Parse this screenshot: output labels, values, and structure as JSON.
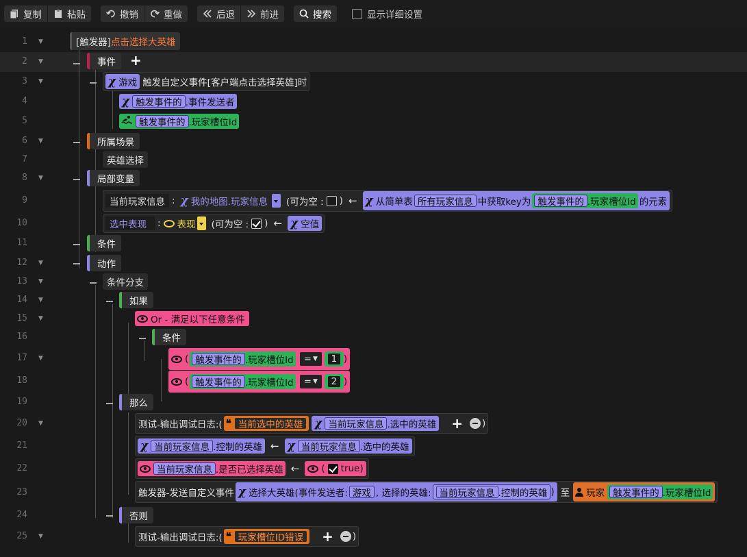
{
  "toolbar": {
    "copy": "复制",
    "paste": "粘贴",
    "undo": "撤销",
    "redo": "重做",
    "back": "后退",
    "forward": "前进",
    "search": "搜索",
    "show_details": "显示详细设置"
  },
  "line_numbers": [
    "1",
    "2",
    "3",
    "4",
    "5",
    "6",
    "7",
    "8",
    "9",
    "10",
    "11",
    "12",
    "13",
    "14",
    "15",
    "16",
    "17",
    "18",
    "19",
    "20",
    "21",
    "22",
    "23",
    "24",
    "25"
  ],
  "colors": {
    "purple": "#8d86e8",
    "green": "#2cb35a",
    "pink": "#f0508c",
    "orange": "#e0701c",
    "yellow": "#f0d24a"
  },
  "lines": {
    "l1": {
      "prefix": "[触发器]",
      "name": "点击选择大英雄"
    },
    "l2": {
      "label": "事件"
    },
    "l3": {
      "tag": "游戏",
      "text": "触发自定义事件[客户端点击选择英雄]时"
    },
    "l4": {
      "inner": "触发事件的",
      "suffix": ".事件发送者"
    },
    "l5": {
      "inner": "触发事件的",
      "suffix": ".玩家槽位Id"
    },
    "l6": {
      "label": "所属场景"
    },
    "l7": {
      "label": "英雄选择"
    },
    "l8": {
      "label": "局部变量"
    },
    "l9": {
      "var": "当前玩家信息",
      "colon": ":",
      "type": "我的地图.玩家信息",
      "nullable": "(可为空 :",
      "close": ")",
      "arrow": "←",
      "fn_prefix": "从简单表",
      "table": "所有玩家信息",
      "fn_mid": "中获取key为",
      "key_inner": "触发事件的",
      "key_suffix": ".玩家槽位Id",
      "fn_suffix": "的元素"
    },
    "l10": {
      "var": "选中表现",
      "colon": ":",
      "type": "表现",
      "nullable": "(可为空 :",
      "close": ")",
      "arrow": "←",
      "value": "空值"
    },
    "l11": {
      "label": "条件"
    },
    "l12": {
      "label": "动作"
    },
    "l13": {
      "label": "条件分支"
    },
    "l14": {
      "label": "如果"
    },
    "l15": {
      "text": "Or - 满足以下任意条件"
    },
    "l16": {
      "label": "条件"
    },
    "l17": {
      "open": "(",
      "inner": "触发事件的",
      "suffix": ".玩家槽位Id",
      "op": "=",
      "value": "1",
      "close": ")"
    },
    "l18": {
      "open": "(",
      "inner": "触发事件的",
      "suffix": ".玩家槽位Id",
      "op": "=",
      "value": "2",
      "close": ")"
    },
    "l19": {
      "label": "那么"
    },
    "l20": {
      "prefix": "测试-输出调试日志:(",
      "str": "当前选中的英雄",
      "inner": "当前玩家信息",
      "suffix": ".选中的英雄",
      "close": ")"
    },
    "l21": {
      "inner1": "当前玩家信息",
      "suffix1": ".控制的英雄",
      "arrow": "←",
      "inner2": "当前玩家信息",
      "suffix2": ".选中的英雄"
    },
    "l22": {
      "inner": "当前玩家信息",
      "suffix": ".是否已选择英雄",
      "arrow": "←",
      "open": "(",
      "value": "true",
      "close": ")"
    },
    "l23": {
      "prefix": "触发器-发送自定义事件",
      "fn": "选择大英雄(事件发送者:",
      "sender": "游戏",
      "sep": ", 选择的英雄:",
      "inner": "当前玩家信息",
      "suffix": ".控制的英雄",
      "close": ")",
      "to": "至",
      "player": "玩家",
      "p_inner": "触发事件的",
      "p_suffix": ".玩家槽位Id"
    },
    "l24": {
      "label": "否则"
    },
    "l25": {
      "prefix": "测试-输出调试日志:(",
      "str": "玩家槽位ID错误",
      "close": ")"
    }
  }
}
